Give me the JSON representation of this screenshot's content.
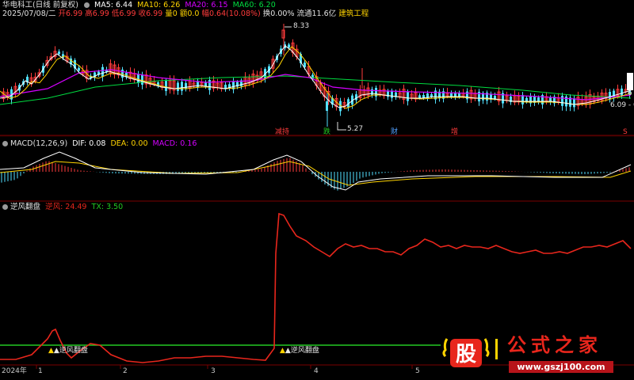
{
  "colors": {
    "bg": "#000000",
    "separator": "#7a0000",
    "up": "#ff3b3b",
    "down": "#52e0ff",
    "ma5": "#ffffff",
    "ma10": "#ffd400",
    "ma20": "#d400ff",
    "ma60": "#00dc40",
    "dif": "#ffffff",
    "dea": "#ffd400",
    "macd": "#d400ff",
    "nifeng": "#e8261c",
    "tx": "#22c922",
    "signal": "#ffd400"
  },
  "price_panel": {
    "title": "华电科工(日线 前复权)",
    "ma_labels": [
      {
        "text": "MA5: 6.44",
        "color": "#ffffff"
      },
      {
        "text": "MA10: 6.26",
        "color": "#ffd400"
      },
      {
        "text": "MA20: 6.15",
        "color": "#d400ff"
      },
      {
        "text": "MA60: 6.20",
        "color": "#00dc40"
      }
    ],
    "info_line": {
      "date": "2025/07/08/二",
      "open": "开6.99",
      "high": "高6.99",
      "low": "低6.99",
      "close": "收6.99",
      "volume": "量0",
      "amount": "额0.0",
      "change": "幅0.64(10.08%)",
      "turnover": "换0.00%",
      "float": "流通11.6亿",
      "sector": "建筑工程"
    },
    "high_label": "8.33",
    "low_label": "5.27",
    "right_label": "6.09 - 6",
    "right_label_top": "6",
    "event_markers": [
      {
        "text": "减持",
        "color": "#ff3b3b"
      },
      {
        "text": "跌",
        "color": "#22c922"
      },
      {
        "text": "财",
        "color": "#52a0ff"
      },
      {
        "text": "增",
        "color": "#ff3b3b"
      },
      {
        "text": "S",
        "color": "#ff3b3b"
      }
    ]
  },
  "macd_panel": {
    "title": "MACD(12,26,9)",
    "dif_label": "DIF: 0.08",
    "dea_label": "DEA: 0.00",
    "macd_label": "MACD: 0.16"
  },
  "indicator_panel": {
    "title": "逆风翻盘",
    "nifeng_label": "逆风: 24.49",
    "tx_label": "TX: 3.50",
    "signal_text": "▲逆风翻盘"
  },
  "time_axis": {
    "labels": [
      "2024年",
      "1",
      "2",
      "3",
      "4",
      "5"
    ]
  },
  "watermark": {
    "logo_char": "股",
    "brand": "公式之家",
    "url": "www.gszj100.com"
  }
}
